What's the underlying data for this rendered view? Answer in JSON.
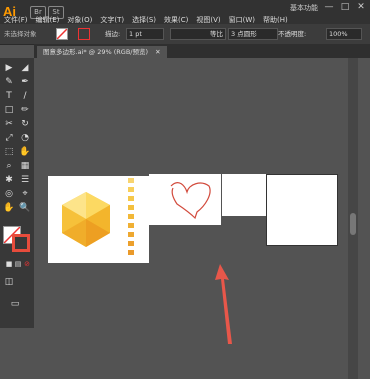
{
  "app": {
    "logo": "Ai",
    "workspace": "基本功能"
  },
  "bridge_icons": [
    "Br",
    "St"
  ],
  "menus": [
    "文件(F)",
    "编辑(E)",
    "对象(O)",
    "文字(T)",
    "选择(S)",
    "效果(C)",
    "视图(V)",
    "窗口(W)",
    "帮助(H)"
  ],
  "window_controls": [
    "—",
    "□",
    "✕"
  ],
  "control_bar": {
    "selection": "未选择对象",
    "stroke_label": "描边:",
    "stroke_value": "1 pt",
    "profile": "等比",
    "brush": "3 点圆形",
    "opacity_label": "不透明度:",
    "opacity_value": "100%"
  },
  "document_tab": {
    "title": "图意多边形.ai* @ 29% (RGB/预览)",
    "close": "✕"
  },
  "tools": [
    "▶",
    "◢",
    "✎",
    "✒",
    "T",
    "/",
    "□",
    "✏",
    "✂",
    "↻",
    "⤢",
    "◔",
    "⬚",
    "✋",
    "⌕",
    "▦",
    "✱",
    "☰",
    "◎",
    "⌖",
    "✋",
    "🔍"
  ],
  "swatch_colors": {
    "fill": "#ffffff",
    "stroke": "#e74c3c",
    "hex_yellow": "#f8c534",
    "heart": "#d24a3c",
    "arrow": "#e8574a"
  }
}
